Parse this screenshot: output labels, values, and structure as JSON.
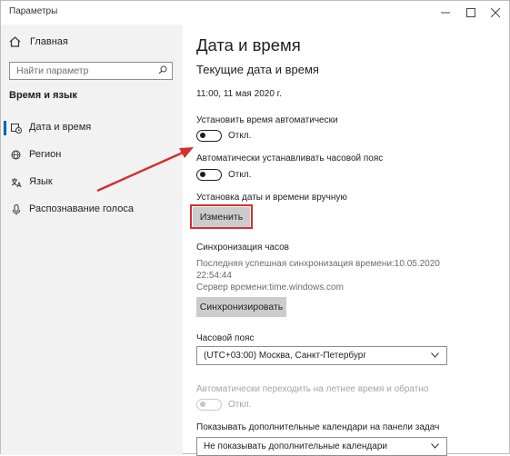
{
  "window": {
    "title": "Параметры"
  },
  "sidebar": {
    "home": "Главная",
    "search_placeholder": "Найти параметр",
    "section": "Время и язык",
    "items": [
      {
        "label": "Дата и время",
        "icon": "calendar-clock-icon",
        "active": true
      },
      {
        "label": "Регион",
        "icon": "globe-gear-icon",
        "active": false
      },
      {
        "label": "Язык",
        "icon": "language-icon",
        "active": false
      },
      {
        "label": "Распознавание голоса",
        "icon": "microphone-icon",
        "active": false
      }
    ]
  },
  "main": {
    "title": "Дата и время",
    "subtitle": "Текущие дата и время",
    "current_datetime": "11:00, 11 мая 2020 г.",
    "auto_time": {
      "label": "Установить время автоматически",
      "state": "Откл."
    },
    "auto_timezone": {
      "label": "Автоматически устанавливать часовой пояс",
      "state": "Откл."
    },
    "manual": {
      "label": "Установка даты и времени вручную",
      "button": "Изменить"
    },
    "sync": {
      "title": "Синхронизация часов",
      "last_sync_line1": "Последняя успешная синхронизация времени:10.05.2020",
      "last_sync_line2": "22:54:44",
      "server": "Сервер времени:time.windows.com",
      "button": "Синхронизировать"
    },
    "timezone": {
      "label": "Часовой пояс",
      "value": "(UTC+03:00) Москва, Санкт-Петербург"
    },
    "dst": {
      "label": "Автоматически переходить на летнее время и обратно",
      "state": "Откл."
    },
    "calendars": {
      "label": "Показывать дополнительные календари на панели задач",
      "value": "Не показывать дополнительные календари"
    }
  },
  "colors": {
    "accent": "#0063b1",
    "highlight": "#d32f2f",
    "sidebar_bg": "#f2f2f2",
    "button_bg": "#cccccc"
  }
}
